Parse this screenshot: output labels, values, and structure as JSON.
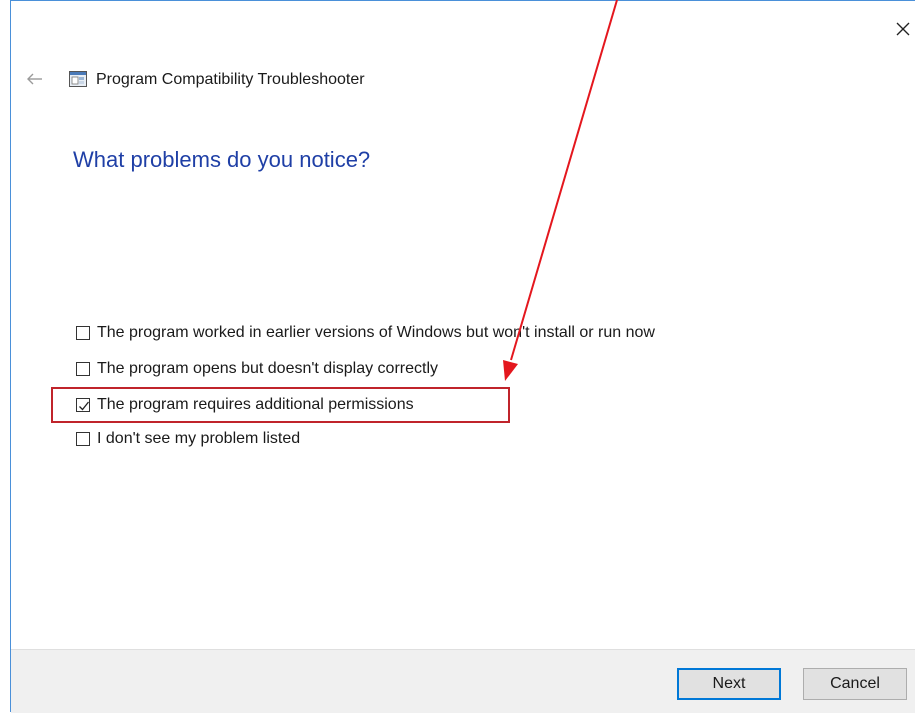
{
  "window": {
    "title": "Program Compatibility Troubleshooter",
    "close_icon": "close-icon",
    "back_icon": "back-arrow-icon",
    "app_icon": "troubleshooter-icon"
  },
  "main": {
    "heading": "What problems do you notice?",
    "options": [
      {
        "label": "The program worked in earlier versions of Windows but won't install or run now",
        "checked": false
      },
      {
        "label": "The program opens but doesn't display correctly",
        "checked": false
      },
      {
        "label": "The program requires additional permissions",
        "checked": true
      },
      {
        "label": "I don't see my problem listed",
        "checked": false
      }
    ]
  },
  "footer": {
    "next_label": "Next",
    "cancel_label": "Cancel"
  },
  "colors": {
    "heading": "#1f3fa6",
    "annotation": "#e4171e",
    "primary_button_border": "#0078d7"
  }
}
